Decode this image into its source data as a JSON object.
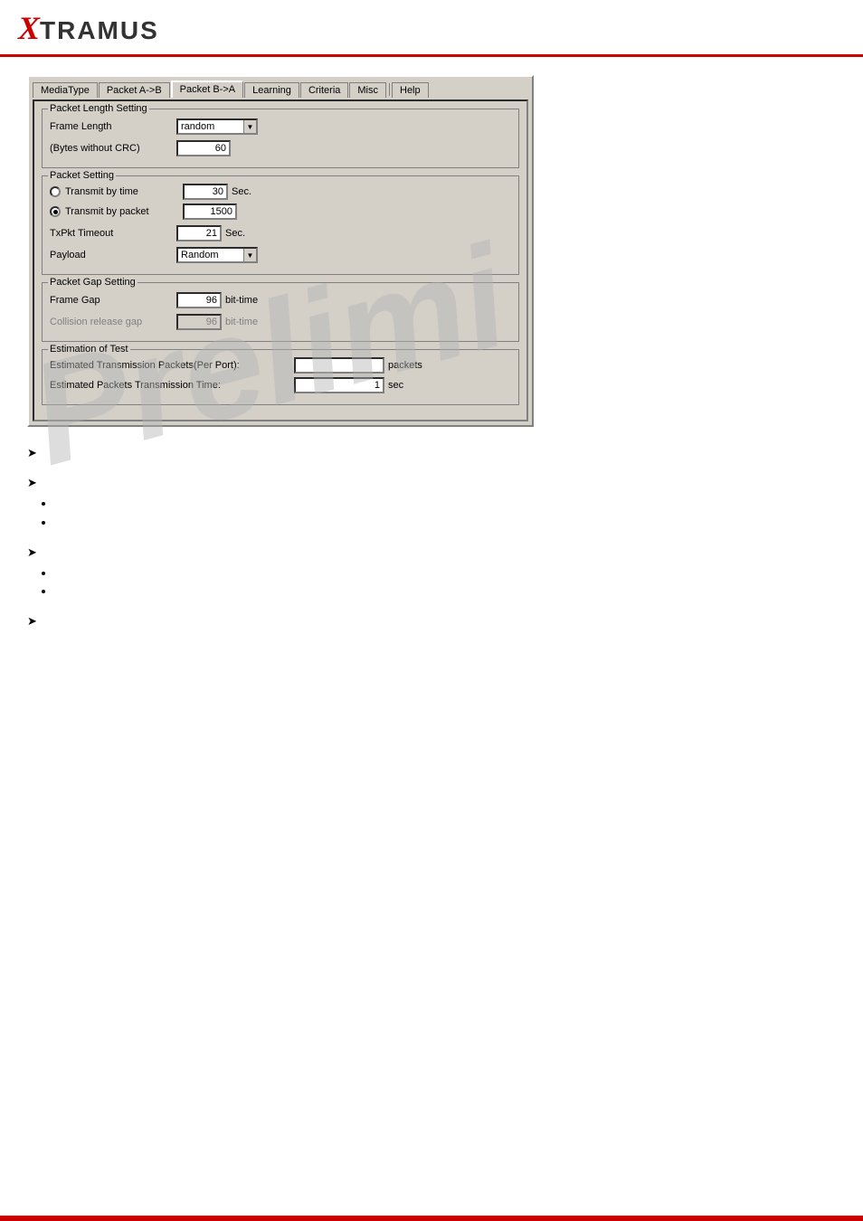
{
  "header": {
    "logo_x": "X",
    "logo_rest": "TRAMUS"
  },
  "tabs": [
    {
      "label": "MediaType",
      "active": false
    },
    {
      "label": "Packet A->B",
      "active": false
    },
    {
      "label": "Packet B->A",
      "active": true
    },
    {
      "label": "Learning",
      "active": false
    },
    {
      "label": "Criteria",
      "active": false
    },
    {
      "label": "Misc",
      "active": false
    },
    {
      "label": "Help",
      "active": false
    }
  ],
  "packet_length_setting": {
    "title": "Packet Length Setting",
    "frame_length_label": "Frame Length",
    "frame_length_value": "random",
    "bytes_label": "(Bytes without CRC)",
    "bytes_value": "60"
  },
  "packet_setting": {
    "title": "Packet Setting",
    "transmit_by_time_label": "Transmit by time",
    "transmit_by_time_value": "30",
    "transmit_by_time_unit": "Sec.",
    "transmit_by_packet_label": "Transmit by packet",
    "transmit_by_packet_value": "1500",
    "txpkt_timeout_label": "TxPkt Timeout",
    "txpkt_timeout_value": "21",
    "txpkt_timeout_unit": "Sec.",
    "payload_label": "Payload",
    "payload_value": "Random"
  },
  "packet_gap_setting": {
    "title": "Packet Gap Setting",
    "frame_gap_label": "Frame Gap",
    "frame_gap_value": "96",
    "frame_gap_unit": "bit-time",
    "collision_label": "Collision release gap",
    "collision_value": "96",
    "collision_unit": "bit-time"
  },
  "estimation_of_test": {
    "title": "Estimation of Test",
    "est_packets_label": "Estimated Transmission Packets(Per Port):",
    "est_packets_value": "",
    "est_packets_unit": "packets",
    "est_time_label": "Estimated Packets Transmission Time:",
    "est_time_value": "1",
    "est_time_unit": "sec"
  },
  "watermark": "Prelimi",
  "sections": [
    {
      "type": "arrow",
      "text": ""
    },
    {
      "type": "arrow",
      "text": "",
      "bullets": [
        "",
        ""
      ]
    },
    {
      "type": "arrow",
      "text": "",
      "bullets": [
        "",
        ""
      ]
    },
    {
      "type": "arrow",
      "text": ""
    }
  ]
}
